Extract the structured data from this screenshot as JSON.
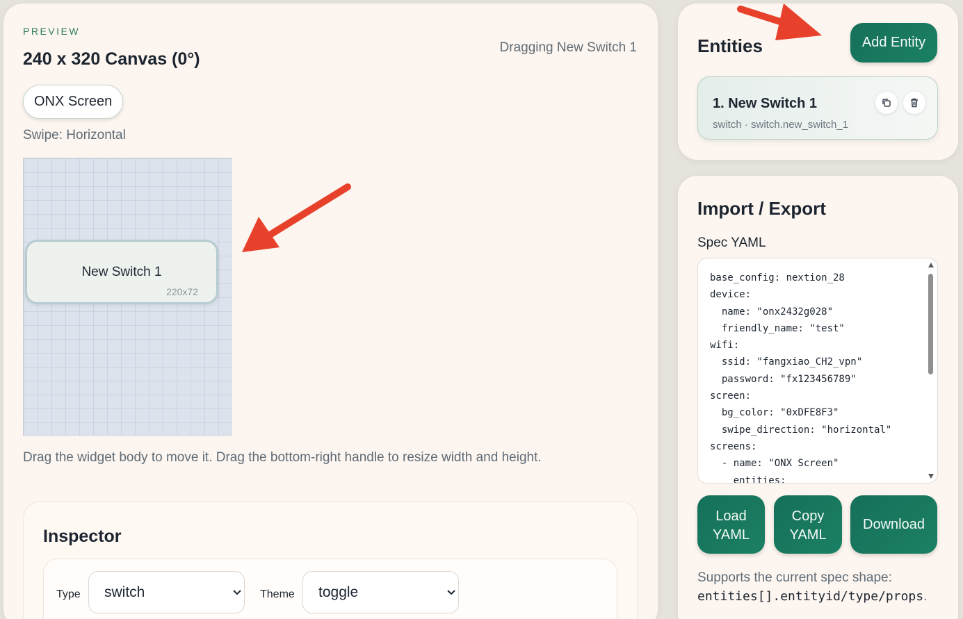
{
  "preview": {
    "eyebrow": "PREVIEW",
    "title": "240 x 320 Canvas (0°)",
    "drag_status": "Dragging New Switch 1",
    "screen_pill": "ONX Screen",
    "swipe": "Swipe: Horizontal",
    "widget": {
      "label": "New Switch 1",
      "size": "220x72"
    },
    "help": "Drag the widget body to move it. Drag the bottom-right handle to resize width and height."
  },
  "inspector": {
    "title": "Inspector",
    "type_label": "Type",
    "type_value": "switch",
    "theme_label": "Theme",
    "theme_value": "toggle"
  },
  "entities": {
    "title": "Entities",
    "add_button": "Add Entity",
    "items": [
      {
        "name": "1. New Switch 1",
        "meta": "switch · switch.new_switch_1"
      }
    ]
  },
  "import_export": {
    "title": "Import / Export",
    "spec_label": "Spec YAML",
    "yaml": "base_config: nextion_28\ndevice:\n  name: \"onx2432g028\"\n  friendly_name: \"test\"\nwifi:\n  ssid: \"fangxiao_CH2_vpn\"\n  password: \"fx123456789\"\nscreen:\n  bg_color: \"0xDFE8F3\"\n  swipe_direction: \"horizontal\"\nscreens:\n  - name: \"ONX Screen\"\n    entities:",
    "load_button_line1": "Load",
    "load_button_line2": "YAML",
    "copy_button_line1": "Copy",
    "copy_button_line2": "YAML",
    "download_button": "Download",
    "supports_text": "Supports the current spec shape:",
    "supports_code": "entities[].entityid/type/props",
    "supports_end": "."
  },
  "colors": {
    "accent": "#16705a",
    "annotation_arrow": "#e8412b",
    "card_bg": "#fdf6f0",
    "canvas_bg": "#dde3ec"
  }
}
